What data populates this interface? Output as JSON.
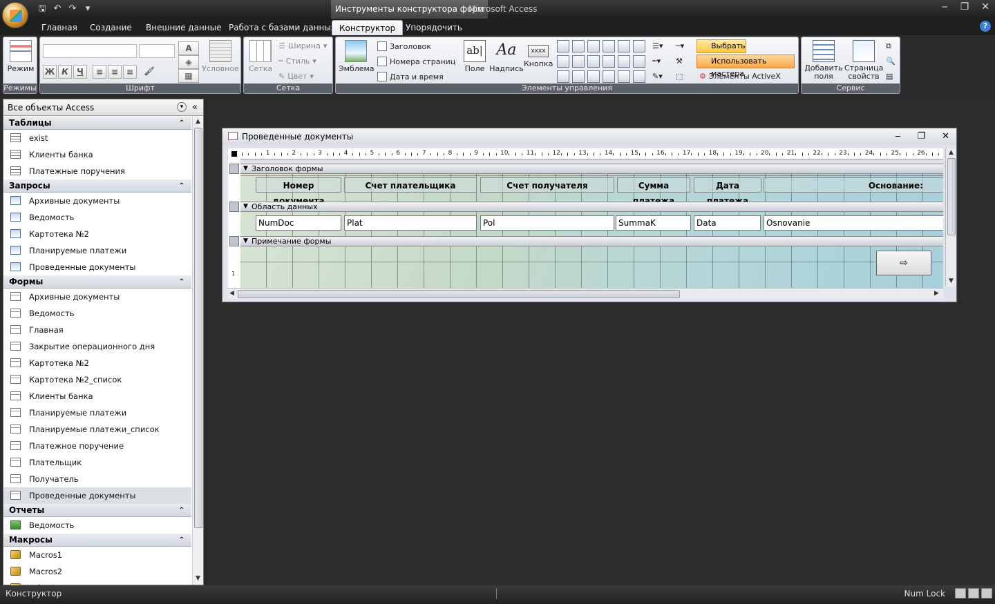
{
  "window": {
    "contextual_tab": "Инструменты конструктора форм",
    "app_title": "Microsoft Access",
    "minimize": "‒",
    "restore": "❐",
    "close": "✕"
  },
  "tabs": [
    "Главная",
    "Создание",
    "Внешние данные",
    "Работа с базами данных",
    "Конструктор",
    "Упорядочить"
  ],
  "active_tab": "Конструктор",
  "ribbon": {
    "modes": {
      "label": "Режимы",
      "view_button": "Режим"
    },
    "font": {
      "label": "Шрифт",
      "bold": "Ж",
      "italic": "К",
      "underline": "Ч",
      "conditional": "Условное"
    },
    "grid": {
      "label": "Сетка",
      "grid_button": "Сетка",
      "width": "Ширина",
      "style": "Стиль",
      "color": "Цвет"
    },
    "controls": {
      "label": "Элементы управления",
      "logo": "Эмблема",
      "title": "Заголовок",
      "page_numbers": "Номера страниц",
      "date_time": "Дата и время",
      "field": "Поле",
      "field_icon_text": "ab|",
      "label_btn": "Надпись",
      "label_icon_text": "Aa",
      "button": "Кнопка",
      "button_icon_text": "xxxx",
      "select": "Выбрать",
      "use_wizards": "Использовать мастера",
      "activex": "Элементы ActiveX"
    },
    "tools": {
      "label": "Сервис",
      "add_fields": "Добавить поля",
      "property_sheet": "Страница свойств"
    }
  },
  "nav_pane": {
    "header": "Все объекты Access",
    "categories": [
      {
        "name": "Таблицы",
        "type": "table",
        "items": [
          "exist",
          "Клиенты банка",
          "Платежные поручения"
        ]
      },
      {
        "name": "Запросы",
        "type": "query",
        "items": [
          "Архивные документы",
          "Ведомость",
          "Картотека №2",
          "Планируемые платежи",
          "Проведенные документы"
        ]
      },
      {
        "name": "Формы",
        "type": "form",
        "items": [
          "Архивные документы",
          "Ведомость",
          "Главная",
          "Закрытие операционного дня",
          "Картотека №2",
          "Картотека №2_список",
          "Клиенты банка",
          "Планируемые платежи",
          "Планируемые платежи_список",
          "Платежное поручение",
          "Плательщик",
          "Получатель",
          "Проведенные документы"
        ]
      },
      {
        "name": "Отчеты",
        "type": "report",
        "items": [
          "Ведомость"
        ]
      },
      {
        "name": "Макросы",
        "type": "macro",
        "items": [
          "Macros1",
          "Macros2",
          "refresh"
        ]
      }
    ],
    "selected_item": "Проведенные документы"
  },
  "form_window": {
    "title": "Проведенные документы",
    "sections": {
      "header": "Заголовок формы",
      "detail": "Область данных",
      "footer": "Примечание формы"
    },
    "header_labels": [
      "Номер документа",
      "Счет плательщика",
      "Счет получателя",
      "Сумма платежа",
      "Дата платежа",
      "Основание:"
    ],
    "detail_fields": [
      "NumDoc",
      "Plat",
      "Pol",
      "SummaK",
      "Data",
      "Osnovanie"
    ],
    "exit_button_glyph": "⇨",
    "ruler_numbers": [
      "1",
      "2",
      "3",
      "4",
      "5",
      "6",
      "7",
      "8",
      "9",
      "10",
      "11",
      "12",
      "13",
      "14",
      "15",
      "16",
      "17",
      "18",
      "19",
      "20",
      "21",
      "22",
      "23",
      "24",
      "25",
      "26"
    ],
    "vruler_numbers": [
      "1"
    ]
  },
  "statusbar": {
    "mode": "Конструктор",
    "numlock": "Num Lock"
  }
}
